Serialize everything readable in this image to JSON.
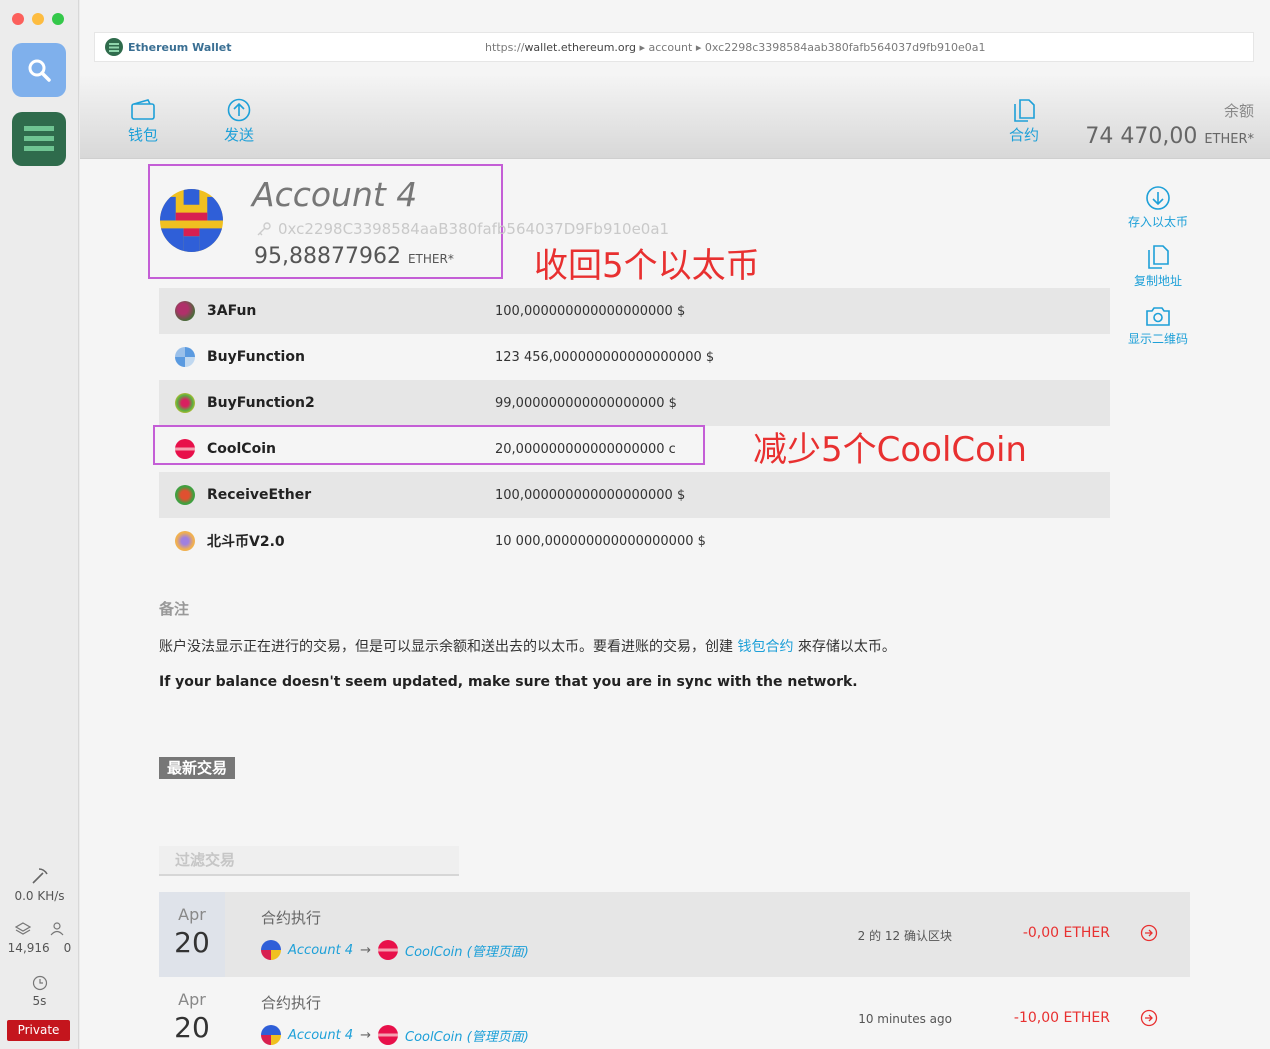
{
  "dock": {
    "hashrate": "0.0 KH/s",
    "blocks": "14,916",
    "peers": "0",
    "time": "5s",
    "network": "Private"
  },
  "urlbar": {
    "brand": "Ethereum Wallet",
    "scheme": "https://",
    "domain": "wallet.ethereum.org",
    "path1": "account",
    "path2": "0xc2298c3398584aab380fafb564037d9fb910e0a1"
  },
  "nav": {
    "wallets": "钱包",
    "send": "发送",
    "contracts": "合约",
    "balance_label": "余额",
    "balance_value": "74 470,00",
    "balance_unit": "ETHER*"
  },
  "account": {
    "name": "Account 4",
    "address": "0xc2298C3398584aaB380fafb564037D9Fb910e0a1",
    "balance": "95,88877962",
    "unit": "ETHER*"
  },
  "annotations": {
    "top": "收回5个以太币",
    "coin": "减少5个CoolCoin"
  },
  "actions": {
    "deposit": "存入以太币",
    "copy": "复制地址",
    "qr": "显示二维码"
  },
  "tokens": [
    {
      "name": "3AFun",
      "value": "100,000000000000000000 $"
    },
    {
      "name": "BuyFunction",
      "value": "123 456,000000000000000000 $"
    },
    {
      "name": "BuyFunction2",
      "value": "99,000000000000000000 $"
    },
    {
      "name": "CoolCoin",
      "value": "20,000000000000000000 c"
    },
    {
      "name": "ReceiveEther",
      "value": "100,000000000000000000 $"
    },
    {
      "name": "北斗币V2.0",
      "value": "10 000,000000000000000000 $"
    }
  ],
  "note": {
    "heading": "备注",
    "text_before": "账户没法显示正在进行的交易，但是可以显示余额和送出去的以太币。要看进账的交易，创建 ",
    "link": "钱包合约",
    "text_after": " 來存储以太币。",
    "sync": "If your balance doesn't seem updated, make sure that you are in sync with the network."
  },
  "latest": "最新交易",
  "filter_placeholder": "过滤交易",
  "transactions": [
    {
      "month": "Apr",
      "day": "20",
      "title": "合约执行",
      "from": "Account 4",
      "to": "CoolCoin (管理页面)",
      "status": "2 的 12 确认区块",
      "amount": "-0,00 ETHER"
    },
    {
      "month": "Apr",
      "day": "20",
      "title": "合约执行",
      "from": "Account 4",
      "to": "CoolCoin (管理页面)",
      "status": "10 minutes ago",
      "amount": "-10,00 ETHER"
    }
  ],
  "colors": {
    "accent": "#1ea0d8",
    "annotation": "#e83030",
    "highlight": "#c45ed6",
    "private": "#c4151d"
  }
}
